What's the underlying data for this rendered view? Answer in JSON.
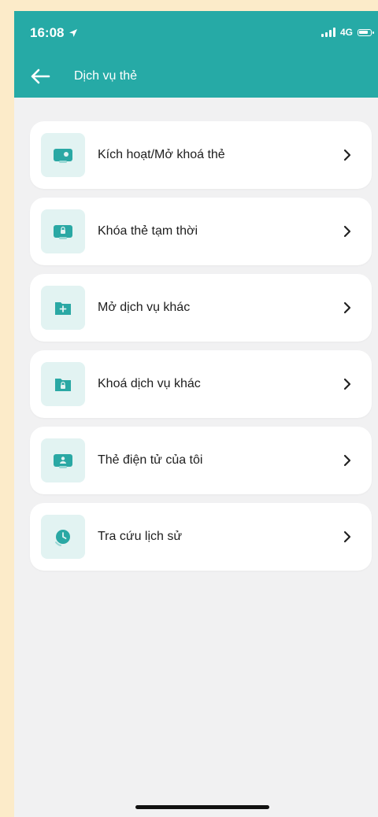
{
  "status_bar": {
    "time": "16:08",
    "network": "4G"
  },
  "header": {
    "title": "Dịch vụ thẻ"
  },
  "menu": {
    "items": [
      {
        "label": "Kích hoạt/Mở khoá thẻ",
        "icon": "card-unlock-icon"
      },
      {
        "label": "Khóa thẻ tạm thời",
        "icon": "card-lock-icon"
      },
      {
        "label": "Mở dịch vụ khác",
        "icon": "folder-add-icon"
      },
      {
        "label": "Khoá dịch vụ khác",
        "icon": "folder-lock-icon"
      },
      {
        "label": "Thẻ điện tử của tôi",
        "icon": "e-card-icon"
      },
      {
        "label": "Tra cứu lịch sử",
        "icon": "history-clock-icon"
      }
    ]
  },
  "colors": {
    "header_bg": "#26aaa6",
    "icon_fg": "#2aa8a4",
    "icon_bg": "#e2f3f2",
    "page_bg": "#f1f1f2"
  }
}
